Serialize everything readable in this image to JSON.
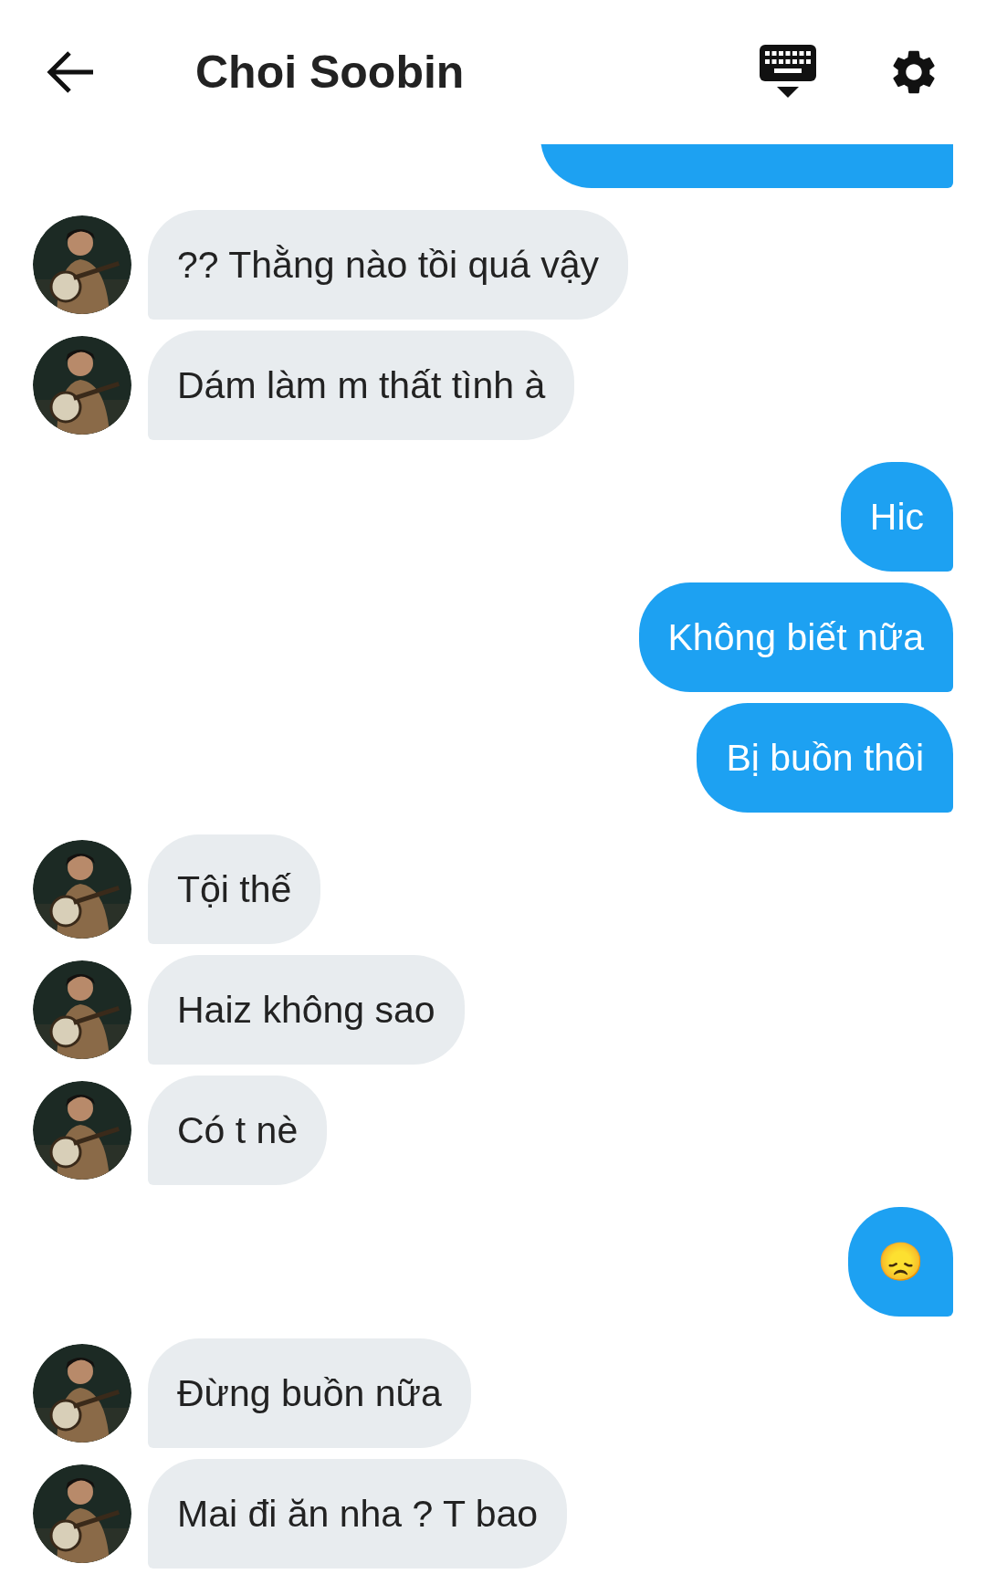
{
  "header": {
    "title": "Choi Soobin"
  },
  "messages": [
    {
      "kind": "clipped"
    },
    {
      "kind": "received",
      "text": "?? Thằng nào tồi quá vậy"
    },
    {
      "kind": "received",
      "text": "Dám làm m thất tình à"
    },
    {
      "kind": "sent",
      "text": "Hic"
    },
    {
      "kind": "sent",
      "text": "Không biết nữa"
    },
    {
      "kind": "sent",
      "text": "Bị buồn thôi"
    },
    {
      "kind": "received",
      "text": "Tội thế"
    },
    {
      "kind": "received",
      "text": "Haiz không sao"
    },
    {
      "kind": "received",
      "text": "Có t nè"
    },
    {
      "kind": "sent",
      "text": "😞"
    },
    {
      "kind": "received",
      "text": "Đừng buồn nữa"
    },
    {
      "kind": "received",
      "text": "Mai đi ăn nha ? T bao"
    }
  ]
}
